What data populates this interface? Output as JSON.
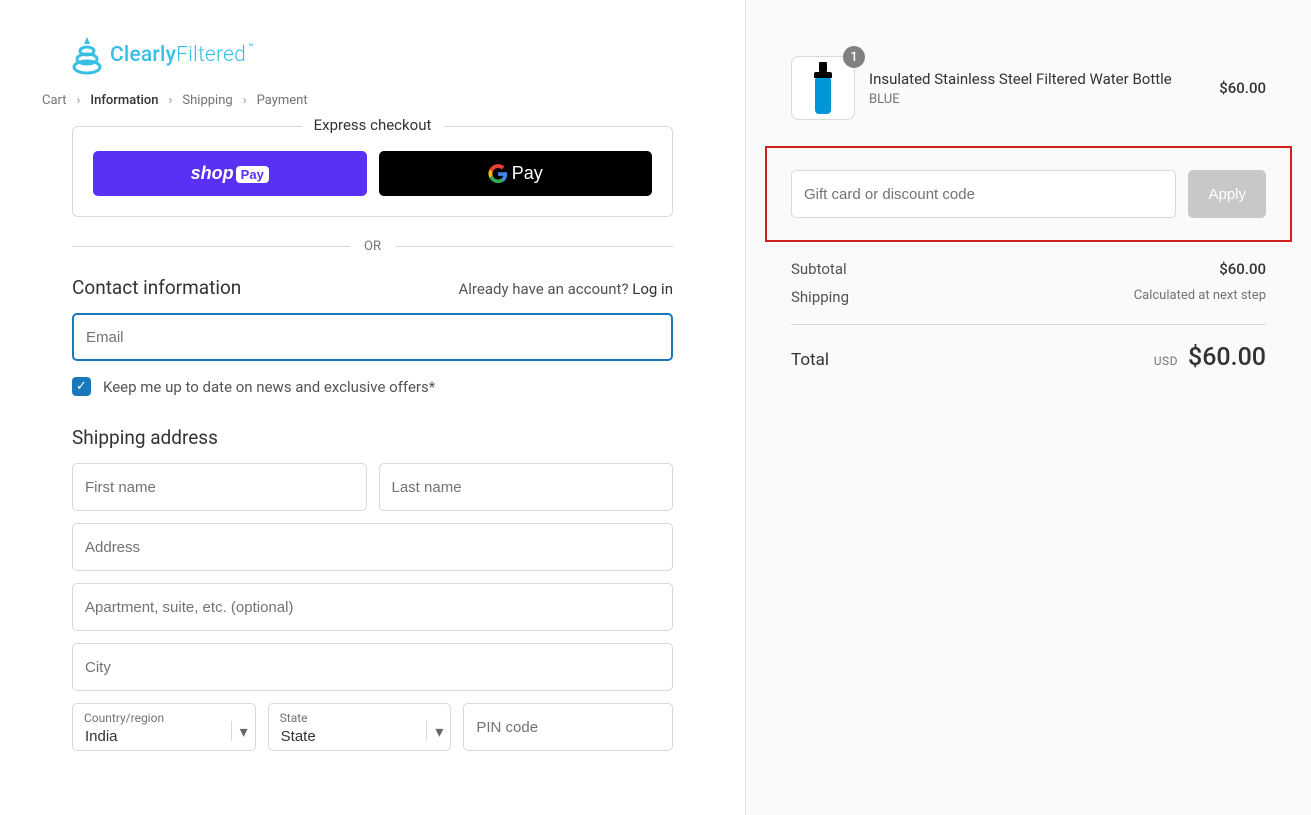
{
  "logo": {
    "brand_a": "Clearly",
    "brand_b": "Filtered"
  },
  "breadcrumb": {
    "cart": "Cart",
    "information": "Information",
    "shipping": "Shipping",
    "payment": "Payment"
  },
  "express": {
    "title": "Express checkout",
    "shop": "shop",
    "pay": "Pay",
    "gpay": "Pay"
  },
  "or": "OR",
  "contact": {
    "title": "Contact information",
    "already": "Already have an account? ",
    "login": "Log in",
    "email_ph": "Email",
    "news_label": "Keep me up to date on news and exclusive offers*"
  },
  "shipping": {
    "title": "Shipping address",
    "first_ph": "First name",
    "last_ph": "Last name",
    "address_ph": "Address",
    "apt_ph": "Apartment, suite, etc. (optional)",
    "city_ph": "City",
    "country_label": "Country/region",
    "country_value": "India",
    "state_label": "State",
    "state_value": "State",
    "pin_ph": "PIN code"
  },
  "cart": {
    "item_name": "Insulated Stainless Steel Filtered Water Bottle",
    "item_variant": "BLUE",
    "item_price": "$60.00",
    "qty": "1"
  },
  "discount": {
    "placeholder": "Gift card or discount code",
    "apply": "Apply"
  },
  "totals": {
    "subtotal_label": "Subtotal",
    "subtotal_value": "$60.00",
    "shipping_label": "Shipping",
    "shipping_note": "Calculated at next step",
    "total_label": "Total",
    "currency": "USD",
    "total_value": "$60.00"
  }
}
